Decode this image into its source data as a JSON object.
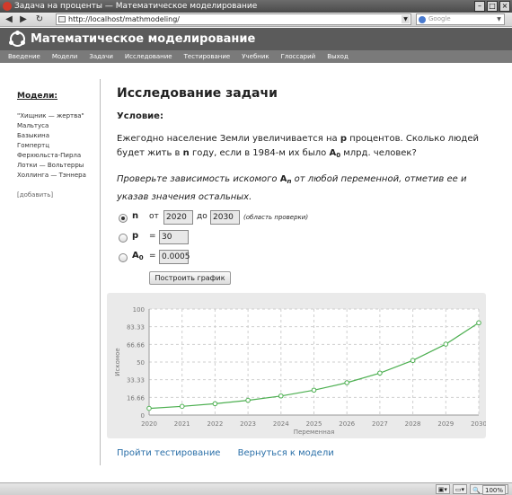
{
  "window": {
    "title": "Задача на проценты — Математическое моделирование"
  },
  "browser": {
    "url": "http://localhost/mathmodeling/",
    "search_placeholder": "Google",
    "zoom": "100%"
  },
  "site": {
    "title": "Математическое моделирование"
  },
  "menu": [
    "Введение",
    "Модели",
    "Задачи",
    "Исследование",
    "Тестирование",
    "Учебник",
    "Глоссарий",
    "Выход"
  ],
  "sidebar": {
    "title": "Модели:",
    "items": [
      "\"Хищник — жертва\"",
      "Мальтуса",
      "Базыкина",
      "Гомпертц",
      "Ферхюльста-Пирла",
      "Лотки — Вольтерры",
      "Холлинга — Тэннера"
    ],
    "add": "[добавить]"
  },
  "main": {
    "heading": "Исследование задачи",
    "condition_label": "Условие:",
    "problem": {
      "t1": "Ежегодно население Земли увеличивается на ",
      "v1": "p",
      "t2": " процентов. Сколько людей будет жить в ",
      "v2": "n",
      "t3": " году, если в 1984-м их было ",
      "v3": "A",
      "v3sub": "0",
      "t4": " млрд. человек?"
    },
    "instruction": {
      "t1": "Проверьте зависимость искомого ",
      "v": "A",
      "vsub": "n",
      "t2": " от любой переменной, отметив ее и указав значения остальных."
    },
    "params": {
      "n": {
        "label": "n",
        "from_label": "от",
        "from": "2020",
        "to_label": "до",
        "to": "2030",
        "note": "(область проверки)"
      },
      "p": {
        "label": "p",
        "eq": "=",
        "value": "30"
      },
      "a0": {
        "label": "A",
        "sub": "0",
        "eq": "=",
        "value": "0.0005"
      }
    },
    "button": "Построить график",
    "links": {
      "test": "Пройти тестирование",
      "back": "Вернуться к модели"
    }
  },
  "chart_data": {
    "type": "line",
    "x": [
      2020,
      2021,
      2022,
      2023,
      2024,
      2025,
      2026,
      2027,
      2028,
      2029,
      2030
    ],
    "values": [
      6.3,
      8.2,
      10.7,
      13.9,
      18.0,
      23.5,
      30.5,
      39.6,
      51.5,
      66.9,
      87.0
    ],
    "yticks": [
      "0",
      "16.66",
      "33.33",
      "50",
      "66.66",
      "83.33",
      "100"
    ],
    "ylim": [
      0,
      100
    ],
    "xlim": [
      2020,
      2030
    ],
    "xlabel": "Переменная",
    "ylabel": "Искомое",
    "color": "#4caf50",
    "grid": true
  }
}
